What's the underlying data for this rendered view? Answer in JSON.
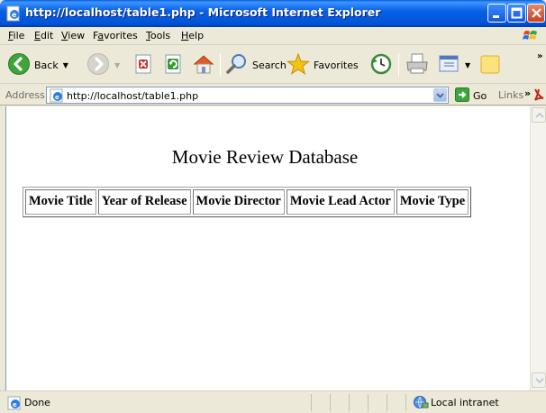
{
  "window": {
    "title": "http://localhost/table1.php - Microsoft Internet Explorer"
  },
  "menu": {
    "items": [
      {
        "key": "F",
        "rest": "ile"
      },
      {
        "key": "E",
        "rest": "dit"
      },
      {
        "key": "V",
        "rest": "iew"
      },
      {
        "pre": "F",
        "key": "a",
        "rest": "vorites"
      },
      {
        "key": "T",
        "rest": "ools"
      },
      {
        "key": "H",
        "rest": "elp"
      }
    ]
  },
  "toolbar": {
    "back_label": "Back",
    "search_label": "Search",
    "favorites_label": "Favorites"
  },
  "address": {
    "label": "Address",
    "value": "http://localhost/table1.php",
    "go_label": "Go",
    "links_label": "Links"
  },
  "page": {
    "heading": "Movie Review Database",
    "table": {
      "headers": [
        "Movie Title",
        "Year of Release",
        "Movie Director",
        "Movie Lead Actor",
        "Movie Type"
      ]
    }
  },
  "status": {
    "text": "Done",
    "zone": "Local intranet"
  }
}
